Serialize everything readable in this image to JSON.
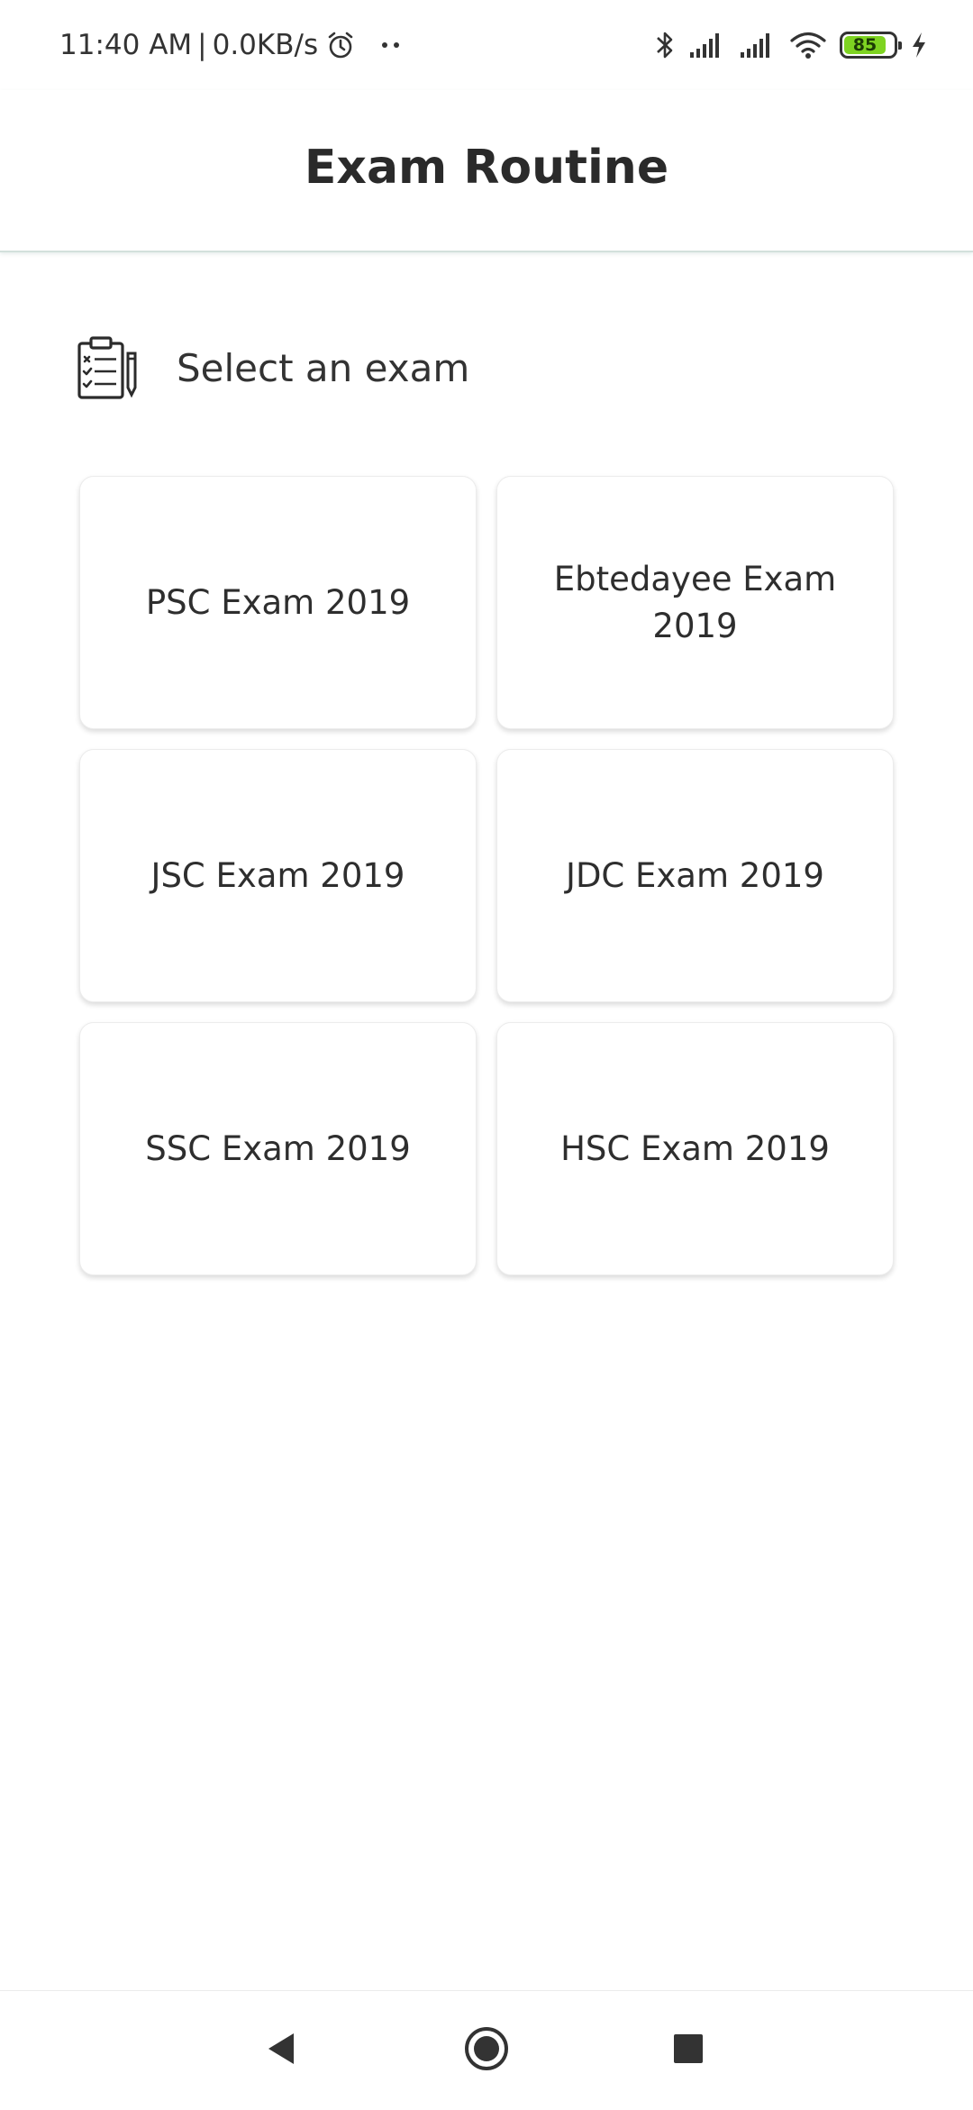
{
  "status_bar": {
    "time": "11:40 AM",
    "separator": "|",
    "network_speed": "0.0KB/s",
    "battery_level": "85",
    "battery_fraction": 0.85,
    "battery_color": "#7ed321",
    "icons": [
      "alarm-icon",
      "dots-icon",
      "bluetooth-icon",
      "signal-icon",
      "signal-icon",
      "wifi-icon",
      "battery-icon",
      "charging-icon"
    ]
  },
  "header": {
    "title": "Exam Routine"
  },
  "section": {
    "icon": "clipboard-checklist-icon",
    "heading": "Select an exam"
  },
  "exams": [
    {
      "label": "PSC Exam 2019"
    },
    {
      "label": "Ebtedayee Exam 2019"
    },
    {
      "label": "JSC Exam 2019"
    },
    {
      "label": "JDC Exam 2019"
    },
    {
      "label": "SSC Exam 2019"
    },
    {
      "label": "HSC Exam 2019"
    }
  ],
  "nav_bar": {
    "buttons": [
      "back-icon",
      "home-icon",
      "recents-icon"
    ]
  }
}
